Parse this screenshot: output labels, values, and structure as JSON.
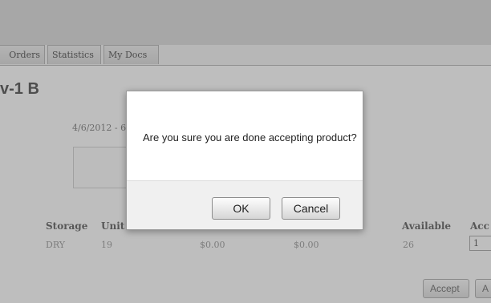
{
  "tabs": [
    {
      "label": "Orders"
    },
    {
      "label": "Statistics"
    },
    {
      "label": "My Docs"
    }
  ],
  "page": {
    "title": "v-1 B",
    "date_range": "4/6/2012 - 6/2"
  },
  "grid": {
    "headers": [
      "Storage",
      "Unit W",
      "Available",
      "Acc"
    ],
    "row": {
      "storage": "DRY",
      "unit": "19",
      "price1": "$0.00",
      "price2": "$0.00",
      "available": "26",
      "accept_qty": "1"
    }
  },
  "actions": {
    "accept_label": "Accept",
    "accept_all_label": "A"
  },
  "dialog": {
    "message": "Are you sure you are done accepting product?",
    "ok_label": "OK",
    "cancel_label": "Cancel"
  }
}
